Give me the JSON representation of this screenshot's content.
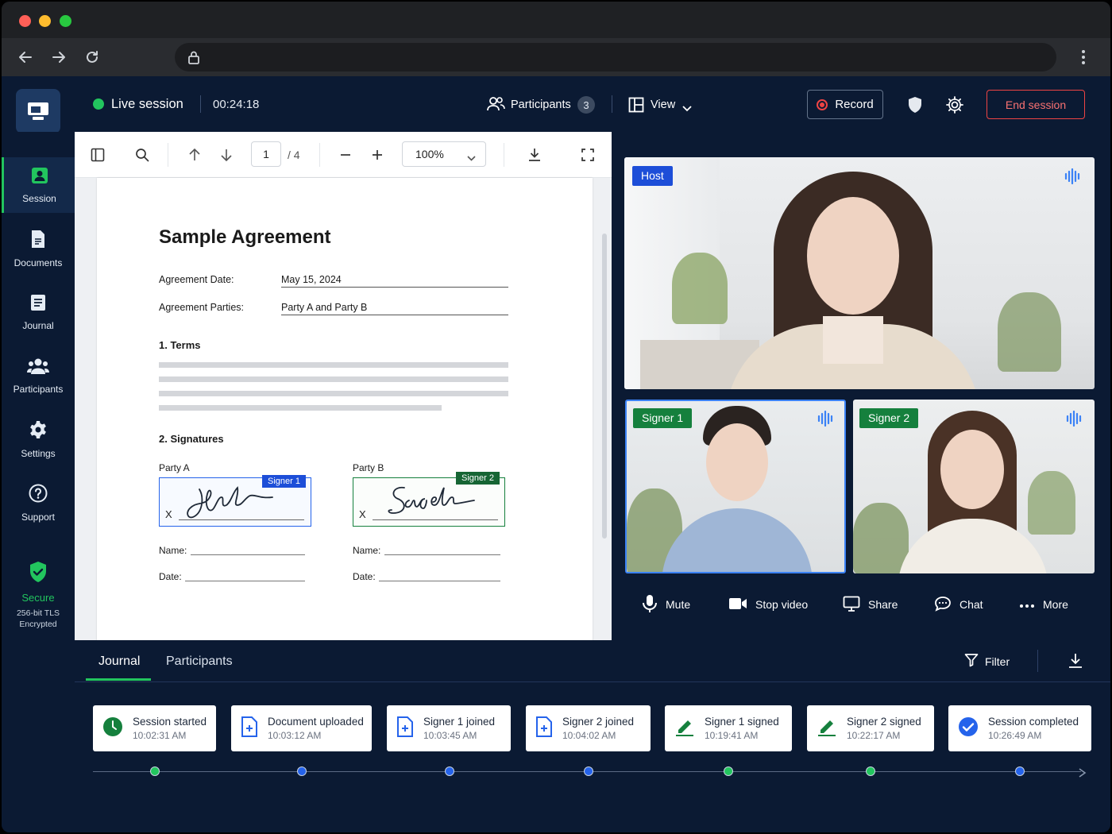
{
  "session": {
    "status": "Live session",
    "timer": "00:24:18",
    "participants_label": "Participants",
    "participants_count": "3",
    "view_label": "View",
    "record_label": "Record",
    "end_label": "End session"
  },
  "sidebar": {
    "items": [
      {
        "label": "Session",
        "icon": "session-icon"
      },
      {
        "label": "Documents",
        "icon": "document-icon"
      },
      {
        "label": "Journal",
        "icon": "journal-icon"
      },
      {
        "label": "Participants",
        "icon": "participants-icon"
      },
      {
        "label": "Settings",
        "icon": "gear-icon"
      },
      {
        "label": "Support",
        "icon": "help-icon"
      }
    ],
    "secure_label": "Secure",
    "secure_sub1": "256-bit TLS",
    "secure_sub2": "Encrypted"
  },
  "viewer": {
    "page_current": "1",
    "page_total": "/ 4",
    "zoom": "100%"
  },
  "document": {
    "title": "Sample Agreement",
    "date_label": "Agreement Date:",
    "date_value": "May 15, 2024",
    "parties_label": "Agreement Parties:",
    "parties_value": "Party A and Party B",
    "section1": "1. Terms",
    "section2": "2. Signatures",
    "party_a": "Party A",
    "party_b": "Party B",
    "signer1_tag": "Signer 1",
    "signer2_tag": "Signer 2",
    "x_mark": "X",
    "name_label": "Name:",
    "date_field_label": "Date:"
  },
  "video": {
    "host_tag": "Host",
    "signer1_tag": "Signer 1",
    "signer2_tag": "Signer 2",
    "controls": {
      "mute": "Mute",
      "stop_video": "Stop video",
      "share": "Share",
      "chat": "Chat",
      "more": "More"
    }
  },
  "journal": {
    "tabs": [
      "Journal",
      "Participants"
    ],
    "filter_label": "Filter",
    "events": [
      {
        "title": "Session started",
        "time": "10:02:31 AM",
        "icon": "clock-icon",
        "color": "#15803d"
      },
      {
        "title": "Document uploaded",
        "time": "10:03:12 AM",
        "icon": "document-add-icon",
        "color": "#2563eb"
      },
      {
        "title": "Signer 1 joined",
        "time": "10:03:45 AM",
        "icon": "document-add-icon",
        "color": "#2563eb"
      },
      {
        "title": "Signer 2 joined",
        "time": "10:04:02 AM",
        "icon": "document-add-icon",
        "color": "#2563eb"
      },
      {
        "title": "Signer 1 signed",
        "time": "10:19:41 AM",
        "icon": "pen-icon",
        "color": "#15803d"
      },
      {
        "title": "Signer 2 signed",
        "time": "10:22:17 AM",
        "icon": "pen-icon",
        "color": "#15803d"
      },
      {
        "title": "Session completed",
        "time": "10:26:49 AM",
        "icon": "check-circle-icon",
        "color": "#2563eb"
      }
    ]
  },
  "colors": {
    "accent_green": "#22c55e",
    "accent_blue": "#2563eb",
    "danger": "#ef4444",
    "background": "#0b1a33"
  }
}
